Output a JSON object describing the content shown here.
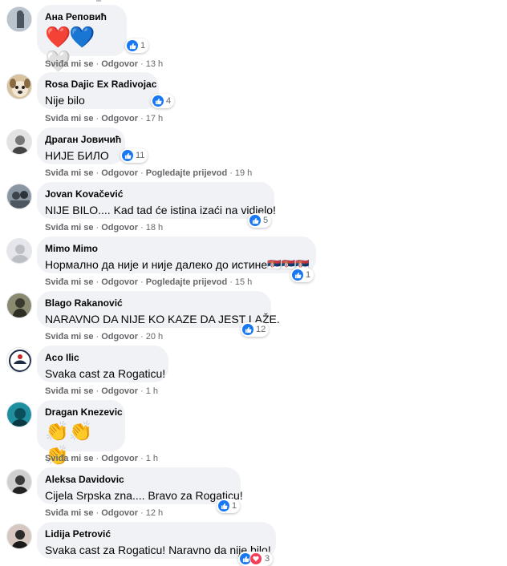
{
  "labels": {
    "like": "Sviđa mi se",
    "reply": "Odgovor",
    "translate": "Pogledajte prijevod"
  },
  "comments": [
    {
      "author": "Ана Реповић",
      "text": "❤️💙🤍",
      "reactions": "1",
      "time": "13 h",
      "translate": false,
      "avatar_color": "#7a8c9a"
    },
    {
      "author": "Rosa Dajic Ex Radivojac",
      "text": "Nije bilo",
      "reactions": "4",
      "time": "17 h",
      "translate": false,
      "avatar_color": "#c9a877"
    },
    {
      "author": "Драган Јовичић",
      "text": "НИЈЕ БИЛО",
      "reactions": "11",
      "time": "19 h",
      "translate": true,
      "avatar_color": "#6d6d6d"
    },
    {
      "author": "Jovan Kovačević",
      "text": "NIJE BILO.... Kad tad će istina izaći na vidjelo!",
      "reactions": "5",
      "time": "18 h",
      "translate": false,
      "avatar_color": "#5c6470"
    },
    {
      "author": "Mimo Mimo",
      "text": "Нормално да није и није далеко до истине🇷🇸🇷🇸🇷🇸",
      "reactions": "1",
      "time": "15 h",
      "translate": true,
      "avatar_color": "#cfd3d8"
    },
    {
      "author": "Blago Rakanović",
      "text": "NARAVNO DA NIJE KO KAZE DA JEST LAŽE.",
      "reactions": "12",
      "time": "20 h",
      "translate": false,
      "avatar_color": "#4a4a3c"
    },
    {
      "author": "Aco Ilic",
      "text": "Svaka cast za Rogaticu!",
      "reactions": "",
      "time": "1 h",
      "translate": false,
      "avatar_color": "#d9dde3"
    },
    {
      "author": "Dragan Knezevic",
      "text": "👏👏👏",
      "reactions": "",
      "time": "1 h",
      "translate": false,
      "avatar_color": "#1f8fa0"
    },
    {
      "author": "Aleksa Davidovic",
      "text": "Cijela Srpska zna.... Bravo za Rogaticu!",
      "reactions": "1",
      "time": "12 h",
      "translate": false,
      "avatar_color": "#3a3a3a"
    },
    {
      "author": "Lidija Petrović",
      "text": "Svaka cast za Rogaticu! Naravno da nije bilo!",
      "reactions": "3",
      "time": "",
      "translate": false,
      "avatar_color": "#2b2b2b"
    }
  ],
  "colors": {
    "like": "#1877f2",
    "love": "#f33e58",
    "bubble": "#f0f2f5",
    "meta": "#65676b"
  }
}
